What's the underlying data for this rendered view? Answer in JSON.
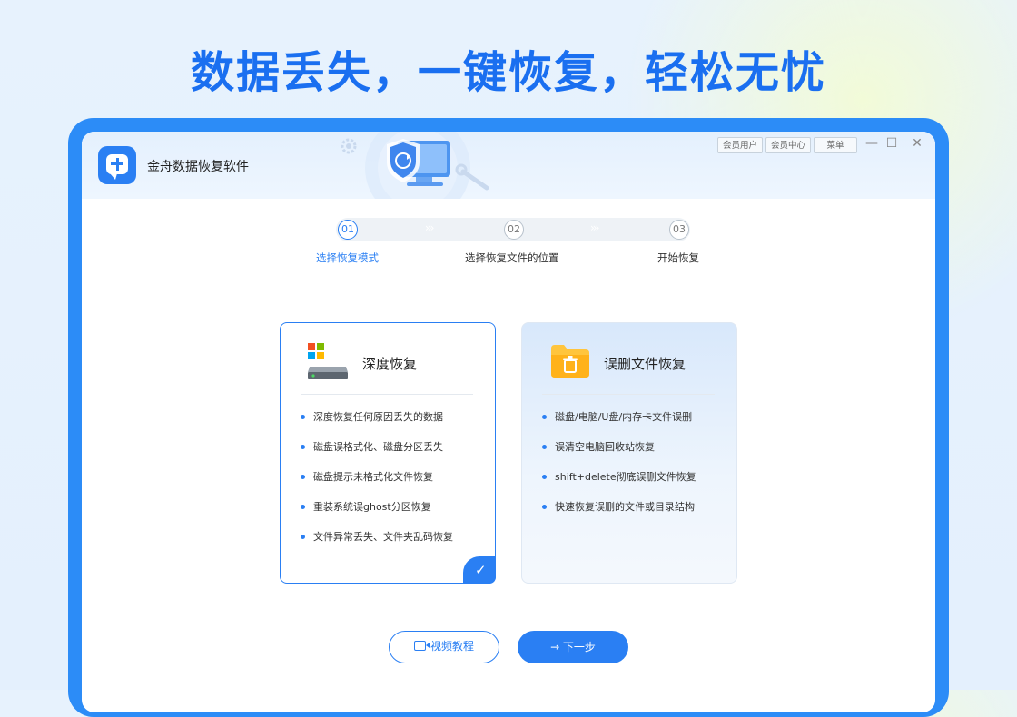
{
  "headline": "数据丢失，一键恢复，轻松无忧",
  "app": {
    "name": "金舟数据恢复软件",
    "toolbar": {
      "member_user": "会员用户",
      "member_center": "会员中心",
      "menu": "菜单"
    },
    "window_controls": [
      "minimize-icon",
      "maximize-icon",
      "close-icon"
    ]
  },
  "steps": [
    {
      "number": "01",
      "label": "选择恢复模式",
      "active": true
    },
    {
      "number": "02",
      "label": "选择恢复文件的位置",
      "active": false
    },
    {
      "number": "03",
      "label": "开始恢复",
      "active": false
    }
  ],
  "modes": [
    {
      "title": "深度恢复",
      "icon": "hard-drive-icon",
      "selected": true,
      "features": [
        "深度恢复任何原因丢失的数据",
        "磁盘误格式化、磁盘分区丢失",
        "磁盘提示未格式化文件恢复",
        "重装系统误ghost分区恢复",
        "文件异常丢失、文件夹乱码恢复"
      ]
    },
    {
      "title": "误删文件恢复",
      "icon": "folder-trash-icon",
      "selected": false,
      "features": [
        "磁盘/电脑/U盘/内存卡文件误删",
        "误清空电脑回收站恢复",
        "shift+delete彻底误删文件恢复",
        "快速恢复误删的文件或目录结构"
      ]
    }
  ],
  "buttons": {
    "video_tutorial": "视频教程",
    "next": "→ 下一步"
  },
  "colors": {
    "accent": "#2a7ff3",
    "headline": "#1a6ff0",
    "frame": "#2c8cf7"
  }
}
